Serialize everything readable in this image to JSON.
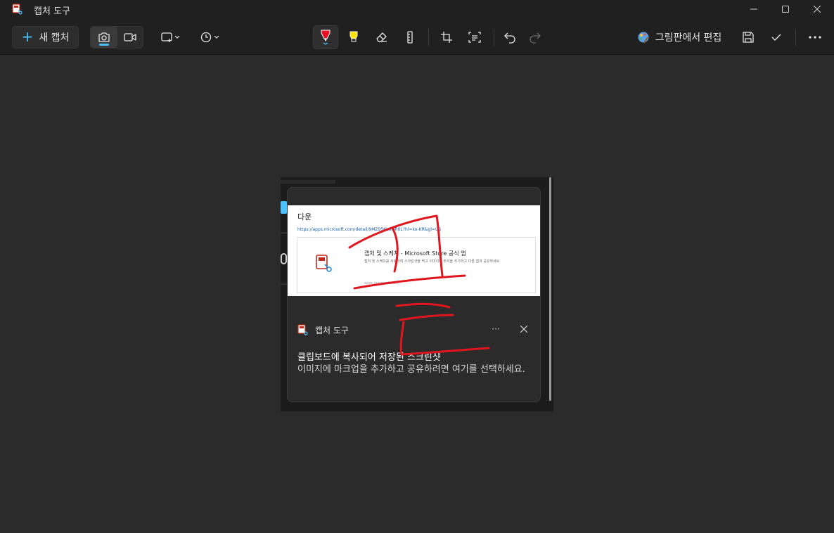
{
  "window": {
    "title": "캡처 도구",
    "controls": [
      "minimize",
      "maximize",
      "close"
    ]
  },
  "toolbar": {
    "new_capture_label": "새 캡처",
    "modes": [
      {
        "name": "screenshot",
        "icon": "camera-icon",
        "active": true
      },
      {
        "name": "record",
        "icon": "video-icon",
        "active": false
      }
    ],
    "capture_shape_icon": "rectangle-snip-icon",
    "delay_icon": "clock-icon",
    "tools": [
      {
        "name": "ballpoint-pen",
        "icon": "pen-icon",
        "color": "#e81123",
        "active": true
      },
      {
        "name": "highlighter",
        "icon": "highlighter-icon",
        "color": "#ffe600"
      },
      {
        "name": "eraser",
        "icon": "eraser-icon"
      },
      {
        "name": "ruler",
        "icon": "ruler-icon"
      },
      {
        "name": "crop",
        "icon": "crop-icon"
      },
      {
        "name": "text-actions",
        "icon": "text-actions-icon"
      },
      {
        "name": "undo",
        "icon": "undo-icon"
      },
      {
        "name": "redo",
        "icon": "redo-icon",
        "enabled": false
      }
    ],
    "edit_in_paint_label": "그림판에서 편집",
    "save_icon": "save-icon",
    "copy_icon": "checkmark-icon",
    "more_icon": "more-icon"
  },
  "screenshot": {
    "preview": {
      "title": "다운",
      "url": "https://apps.microsoft.com/detail/9MZ95KL8MR0L?hl=ko-KR&gl=US",
      "card_title": "캡처 및 스케치 - Microsoft Store 공식 앱",
      "card_desc": "캡처 및 스케치를 사용하여 스크린샷을 찍고 이미지에 주석을 추가하고 다른 앱과 공유하세요.",
      "card_domain": "apps.microsoft.com"
    },
    "toast": {
      "app_name": "캡처 도구",
      "more_label": "···",
      "heading": "클립보드에 복사되어 저장된 스크린샷",
      "body": "이미지에 마크업을 추가하고 공유하려면 여기를 선택하세요."
    },
    "ink_color": "#e0161e"
  },
  "colors": {
    "accent": "#4cc2ff",
    "pen": "#e81123",
    "highlighter": "#ffe600",
    "background": "#202020",
    "canvas": "#2b2b2b"
  }
}
